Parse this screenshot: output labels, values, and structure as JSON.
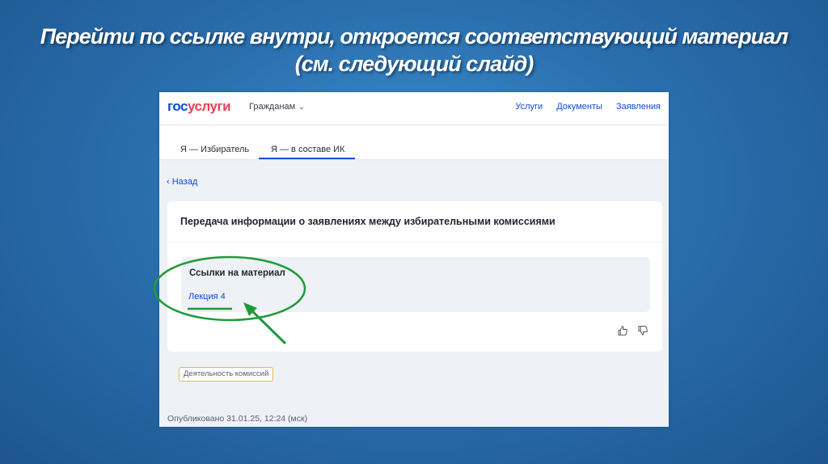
{
  "slide": {
    "title_line1": "Перейти по ссылке внутри, откроется соответствующий материал",
    "title_line2": "(см. следующий слайд)"
  },
  "header": {
    "logo_part1": "гос",
    "logo_part2": "услуги",
    "citizens": "Гражданам",
    "nav": [
      "Услуги",
      "Документы",
      "Заявления"
    ]
  },
  "tabs": [
    "Я — Избиратель",
    "Я — в составе ИК"
  ],
  "active_tab": 1,
  "back": "Назад",
  "card": {
    "title": "Передача информации о заявлениях между избирательными комиссиями",
    "links_title": "Ссылки на материал",
    "link": "Лекция 4"
  },
  "tag": "Деятельность комиссий",
  "published": "Опубликовано 31.01.25, 12:24 (мск)",
  "colors": {
    "accent": "#0d4cd3",
    "logo_red": "#ee3f58",
    "annotation_green": "#1f9a3a",
    "slide_background": "#2a6fae"
  },
  "icons": [
    "chevron-down-icon",
    "chevron-left-icon",
    "thumbs-up-icon",
    "thumbs-down-icon"
  ]
}
